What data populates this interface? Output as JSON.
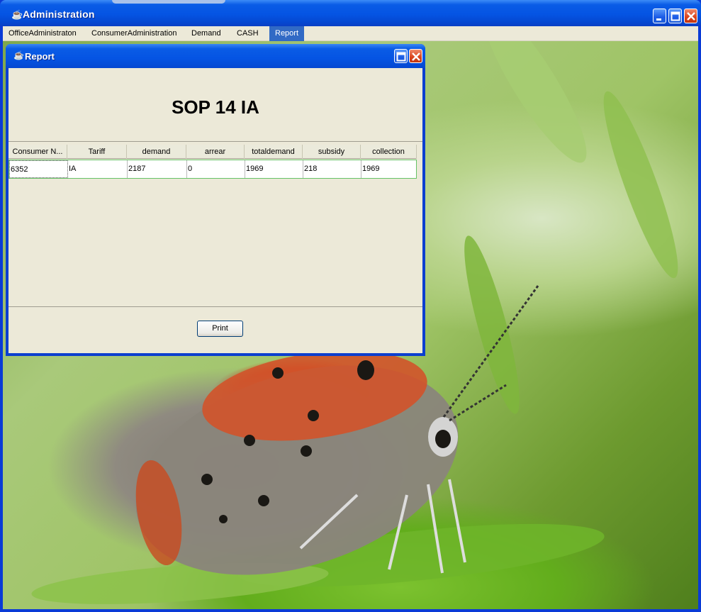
{
  "window": {
    "title": "Administration",
    "icon": "java-cup-icon"
  },
  "menubar": {
    "items": [
      "OfficeAdministraton",
      "ConsumerAdministration",
      "Demand",
      "CASH",
      "Report"
    ],
    "active": "Report"
  },
  "report": {
    "title": "Report",
    "heading": "SOP 14  IA",
    "columns": [
      "Consumer N...",
      "Tariff",
      "demand",
      "arrear",
      "totaldemand",
      "subsidy",
      "collection"
    ],
    "rows": [
      [
        "6352",
        "IA",
        "2187",
        "0",
        "1969",
        "218",
        "1969"
      ]
    ],
    "print_label": "Print"
  },
  "colors": {
    "titlebar": "#0554e3",
    "menu_active": "#316ac5",
    "panel": "#ece9d8",
    "row_border": "#66c266"
  }
}
